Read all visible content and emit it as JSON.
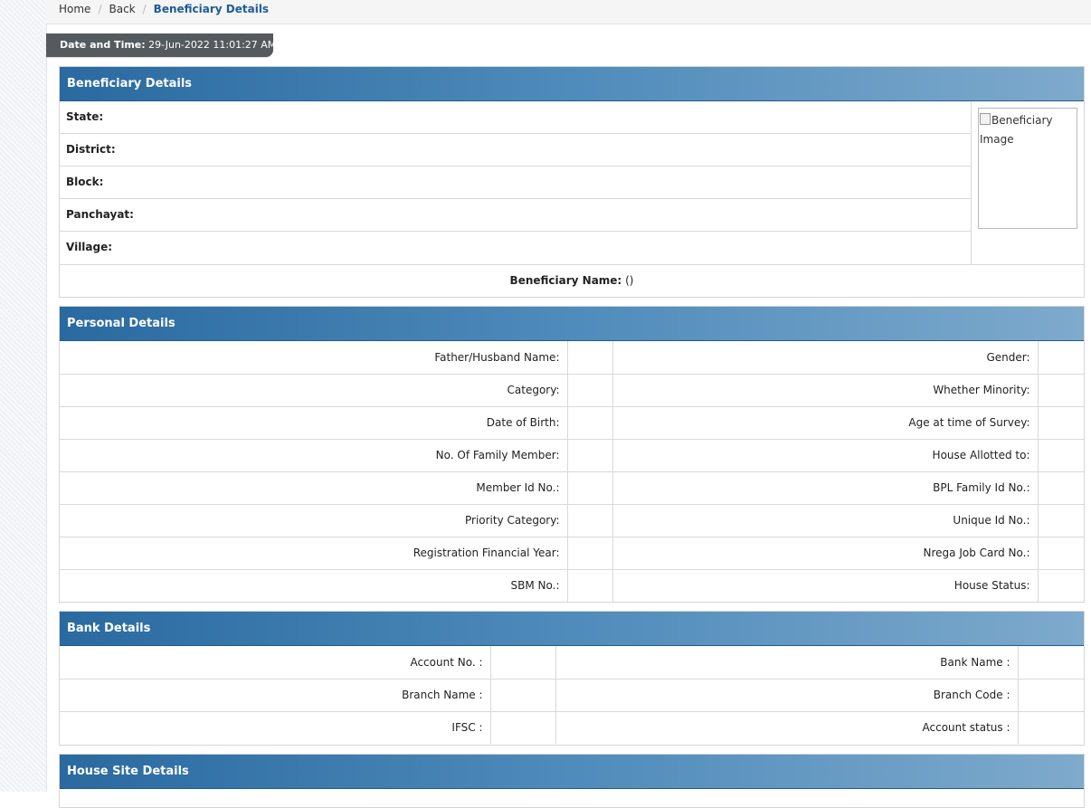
{
  "breadcrumb": {
    "home": "Home",
    "back": "Back",
    "current": "Beneficiary Details"
  },
  "datetime": {
    "label": "Date and Time:",
    "value": "29-Jun-2022 11:01:27 AM"
  },
  "beneficiary": {
    "title": "Beneficiary Details",
    "fields": [
      "State:",
      "District:",
      "Block:",
      "Panchayat:",
      "Village:"
    ],
    "image_alt": "Beneficiary Image",
    "name_label": "Beneficiary Name:",
    "name_value": "()"
  },
  "personal": {
    "title": "Personal Details",
    "rows": [
      {
        "left": "Father/Husband Name:",
        "right": "Gender:"
      },
      {
        "left": "Category:",
        "right": "Whether Minority:"
      },
      {
        "left": "Date of Birth:",
        "right": "Age at time of Survey:"
      },
      {
        "left": "No. Of Family Member:",
        "right": "House Allotted to:"
      },
      {
        "left": "Member Id No.:",
        "right": "BPL Family Id No.:"
      },
      {
        "left": "Priority Category:",
        "right": "Unique Id No.:"
      },
      {
        "left": "Registration Financial Year:",
        "right": "Nrega Job Card No.:"
      },
      {
        "left": "SBM No.:",
        "right": "House Status:"
      }
    ]
  },
  "bank": {
    "title": "Bank Details",
    "rows": [
      {
        "left": "Account No. :",
        "right": "Bank Name :"
      },
      {
        "left": "Branch Name :",
        "right": "Branch Code :"
      },
      {
        "left": "IFSC :",
        "right": "Account status :"
      }
    ]
  },
  "house_site": {
    "title": "House Site Details"
  }
}
